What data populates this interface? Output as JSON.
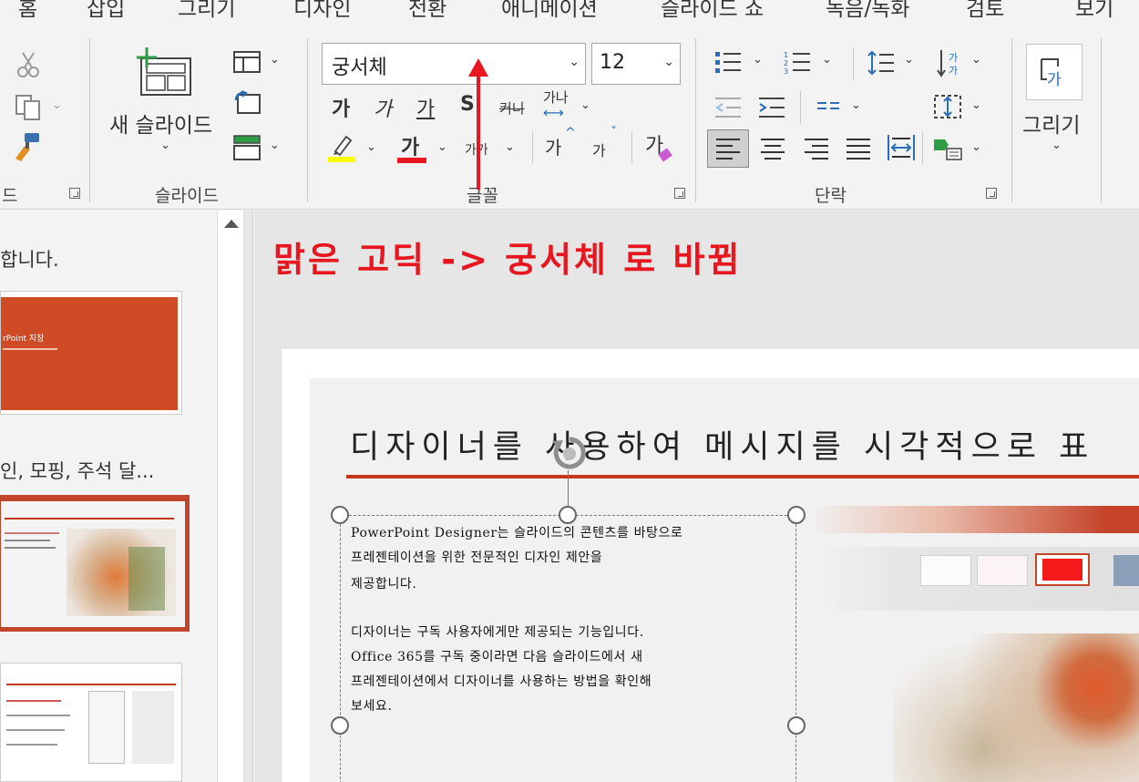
{
  "tabs": [
    "홈",
    "삽입",
    "그리기",
    "디자인",
    "전환",
    "애니메이션",
    "슬라이드 쇼",
    "녹음/녹화",
    "검토",
    "보기"
  ],
  "ribbon": {
    "new_slide_label_line1": "새 슬라이드",
    "groups": {
      "clipboard_partial": "드",
      "slides": "슬라이드",
      "font": "글꼴",
      "paragraph": "단락",
      "drawing_label": "그리기"
    },
    "font": {
      "name": "궁서체",
      "size": "12",
      "bold_glyph": "가",
      "italic_glyph": "가",
      "underline_glyph": "가",
      "strike_glyph": "S",
      "strike2_glyph": "커니",
      "spacing_glyph": "가나",
      "fontcolor_glyph": "가",
      "case_glyph": "가가",
      "grow_glyph": "가",
      "shrink_glyph": "가",
      "clear_glyph": "가"
    },
    "colors": {
      "highlight": "#ffff00",
      "font_color": "#e8161f"
    }
  },
  "annotation": "맑은 고딕 -> 궁서체 로 바뀜",
  "thumbnails": {
    "heading1": "합니다.",
    "slide1_title": "rPoint 지장",
    "heading2": "인, 모핑, 주석 달..."
  },
  "slide": {
    "title": "디자이너를 사용하여 메시지를 시각적으로 표",
    "body_lines": [
      "PowerPoint Designer는 슬라이드의 콘텐츠를 바탕으로",
      "프레젠테이션을 위한 전문적인 디자인 제안을",
      "제공합니다.",
      "",
      "디자이너는 구독 사용자에게만 제공되는 기능입니다.",
      "Office 365를 구독 중이라면 다음 슬라이드에서 새",
      "프레젠테이션에서 디자이너를 사용하는 방법을 확인해",
      "보세요."
    ],
    "accent_color": "#c0391b"
  }
}
